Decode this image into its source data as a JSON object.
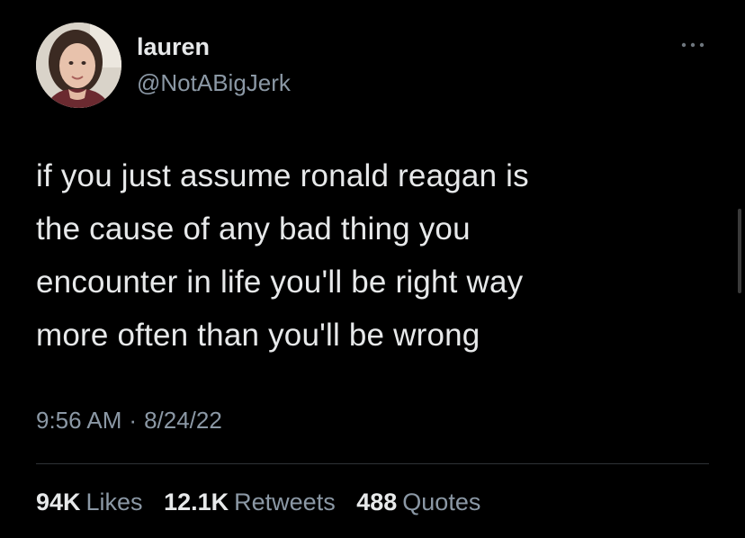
{
  "user": {
    "display_name": "lauren",
    "handle": "@NotABigJerk",
    "avatar_icon": "profile-photo"
  },
  "tweet": {
    "lines": [
      "if you just assume ronald reagan is",
      "the cause of any bad thing you",
      "encounter in life you'll be right way",
      "more often than you'll be wrong"
    ],
    "time": "9:56 AM",
    "separator": "·",
    "date": "8/24/22"
  },
  "stats": {
    "likes_count": "94K",
    "likes_label": "Likes",
    "retweets_count": "12.1K",
    "retweets_label": "Retweets",
    "quotes_count": "488",
    "quotes_label": "Quotes"
  },
  "actions": {
    "more_icon": "more-horizontal-icon"
  },
  "colors": {
    "background": "#000000",
    "primary_text": "#e7e9ea",
    "secondary_text": "#8b98a5",
    "divider": "#2f3336"
  }
}
